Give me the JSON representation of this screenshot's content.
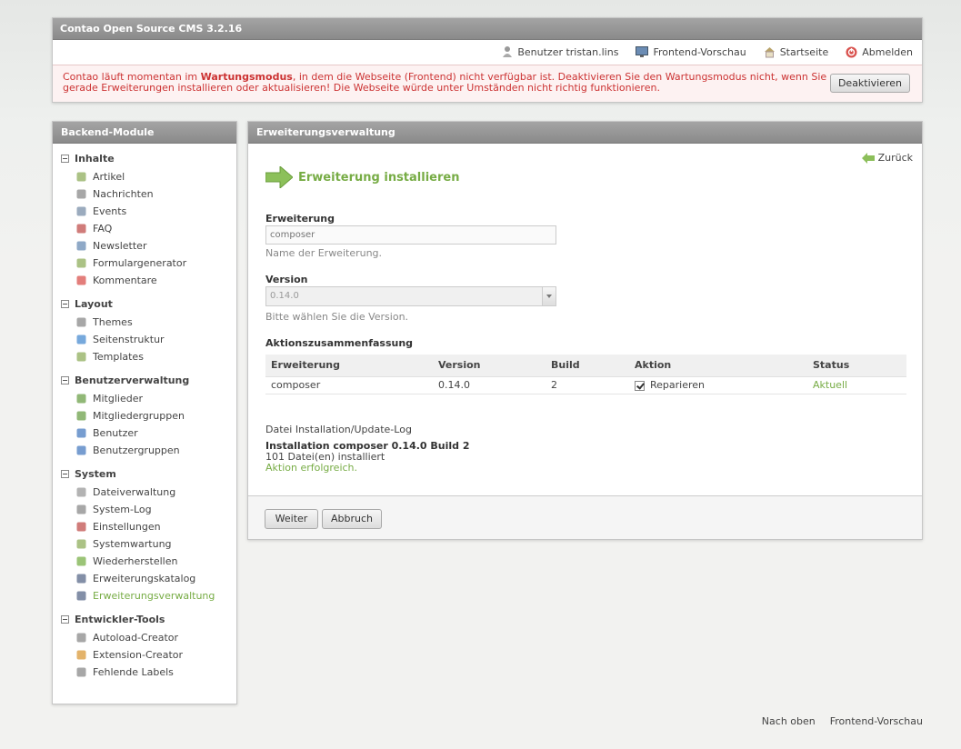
{
  "header": {
    "title": "Contao Open Source CMS 3.2.16",
    "nav": {
      "user": "Benutzer tristan.lins",
      "preview": "Frontend-Vorschau",
      "home": "Startseite",
      "logout": "Abmelden"
    },
    "maintenance": {
      "before": "Contao läuft momentan im ",
      "strong": "Wartungsmodus",
      "after": ", in dem die Webseite (Frontend) nicht verfügbar ist. Deaktivieren Sie den Wartungsmodus nicht, wenn Sie gerade Erweiterungen installieren oder aktualisieren! Die Webseite würde unter Umständen nicht richtig funktionieren.",
      "button": "Deaktivieren"
    }
  },
  "sidebar": {
    "title": "Backend-Module",
    "groups": [
      {
        "label": "Inhalte",
        "items": [
          "Artikel",
          "Nachrichten",
          "Events",
          "FAQ",
          "Newsletter",
          "Formulargenerator",
          "Kommentare"
        ]
      },
      {
        "label": "Layout",
        "items": [
          "Themes",
          "Seitenstruktur",
          "Templates"
        ]
      },
      {
        "label": "Benutzerverwaltung",
        "items": [
          "Mitglieder",
          "Mitgliedergruppen",
          "Benutzer",
          "Benutzergruppen"
        ]
      },
      {
        "label": "System",
        "items": [
          "Dateiverwaltung",
          "System-Log",
          "Einstellungen",
          "Systemwartung",
          "Wiederherstellen",
          "Erweiterungskatalog",
          "Erweiterungsverwaltung"
        ]
      },
      {
        "label": "Entwickler-Tools",
        "items": [
          "Autoload-Creator",
          "Extension-Creator",
          "Fehlende Labels"
        ]
      }
    ],
    "active_item": "Erweiterungsverwaltung"
  },
  "main": {
    "title": "Erweiterungsverwaltung",
    "back": "Zurück",
    "page_title": "Erweiterung installieren",
    "extension_label": "Erweiterung",
    "extension_placeholder": "composer",
    "extension_help": "Name der Erweiterung.",
    "version_label": "Version",
    "version_value": "0.14.0",
    "version_help": "Bitte wählen Sie die Version.",
    "summary_label": "Aktionszusammenfassung",
    "table": {
      "headers": [
        "Erweiterung",
        "Version",
        "Build",
        "Aktion",
        "Status"
      ],
      "row": {
        "extension": "composer",
        "version": "0.14.0",
        "build": "2",
        "action": "Reparieren",
        "status": "Aktuell"
      }
    },
    "log_title": "Datei Installation/Update-Log",
    "log_heading": "Installation composer 0.14.0 Build 2",
    "log_count": "101 Datei(en) installiert",
    "log_result": "Aktion erfolgreich.",
    "continue_button": "Weiter",
    "cancel_button": "Abbruch"
  },
  "footer": {
    "top": "Nach oben",
    "preview": "Frontend-Vorschau"
  },
  "colors": {
    "accent_green": "#77ac45",
    "warning_red": "#cc3333",
    "bar_gray": "#999999"
  }
}
